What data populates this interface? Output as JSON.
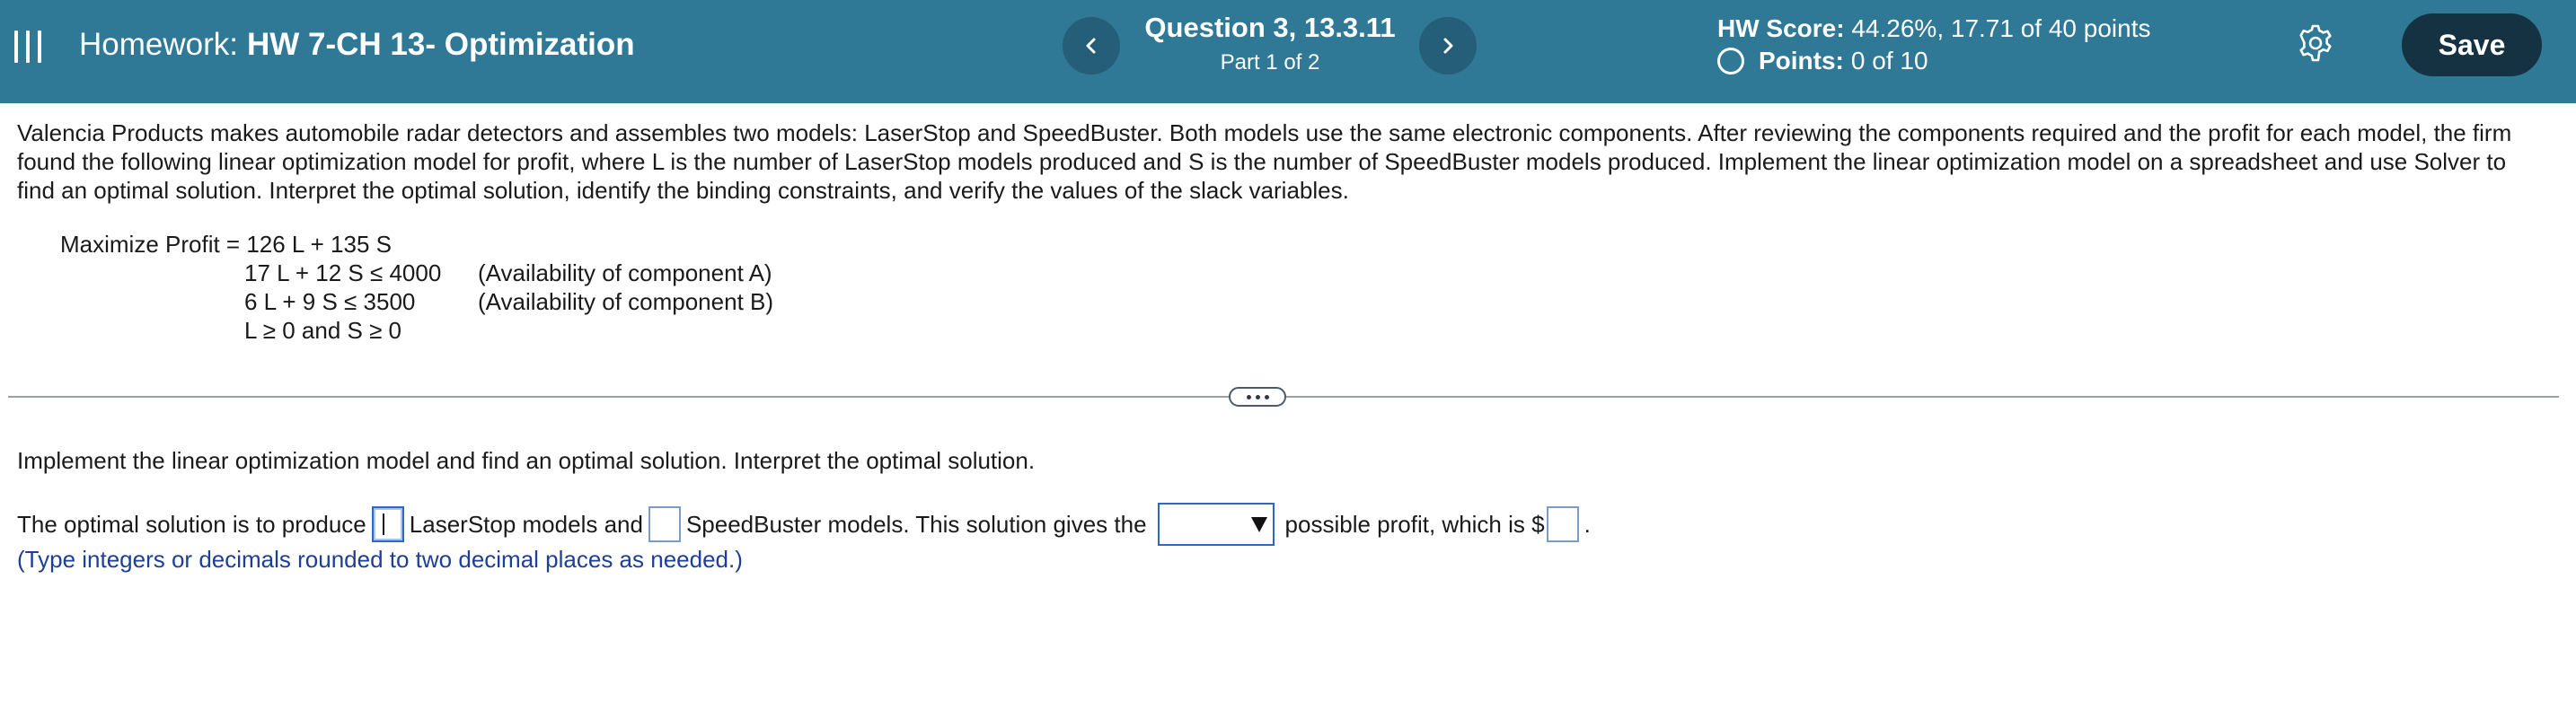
{
  "header": {
    "homework_label": "Homework:",
    "homework_name": "HW 7-CH 13- Optimization",
    "question_title": "Question 3, 13.3.11",
    "question_part": "Part 1 of 2",
    "score_label": "HW Score:",
    "score_value": "44.26%, 17.71 of 40 points",
    "points_label": "Points:",
    "points_value": "0 of 10",
    "save_label": "Save",
    "icons": [
      "menu-icon",
      "chevron-left-icon",
      "chevron-right-icon",
      "circle-icon",
      "gear-icon"
    ],
    "colors": {
      "header_bg": "#2f7896",
      "nav_button": "#245e78",
      "save_button": "#153243"
    }
  },
  "problem": {
    "text": "Valencia Products makes automobile radar detectors and assembles two models: LaserStop and SpeedBuster. Both models use the same electronic components. After reviewing the components required and the profit for each model, the firm found the following linear optimization model for profit, where L is the number of LaserStop models produced and S is the number of SpeedBuster models produced. Implement the linear optimization model on a spreadsheet and use Solver to find an optimal solution. Interpret the optimal solution, identify the binding constraints, and verify the values of the slack variables.",
    "objective": "Maximize Profit = 126 L + 135 S",
    "constraints": [
      {
        "expr": "17 L + 12 S ≤ 4000",
        "note": "(Availability of component A)"
      },
      {
        "expr": "6 L + 9 S ≤ 3500",
        "note": "(Availability of component B)"
      },
      {
        "expr": "L ≥ 0 and S ≥ 0",
        "note": ""
      }
    ]
  },
  "part": {
    "instruction": "Implement the linear optimization model and find an optimal solution. Interpret the optimal solution.",
    "answer_text_1": "The optimal solution is to produce",
    "answer_text_2": "LaserStop models and",
    "answer_text_3": "SpeedBuster models. This solution gives the",
    "answer_text_4": "possible profit, which is $",
    "answer_text_5": ".",
    "laserstop_value": "",
    "speedbuster_value": "",
    "profit_type_selected": "",
    "profit_value": "",
    "hint": "(Type integers or decimals rounded to two decimal places as needed.)"
  }
}
